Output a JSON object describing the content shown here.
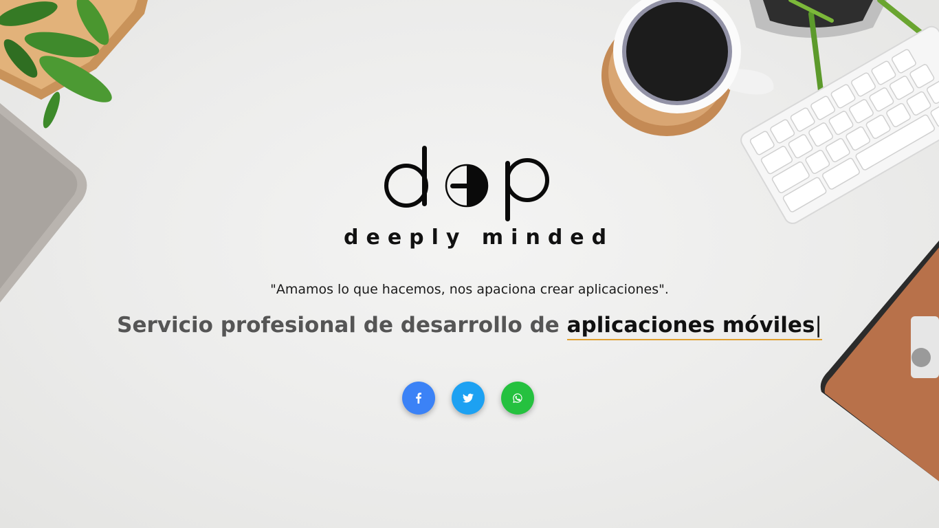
{
  "brand": {
    "logo_mark": "dep",
    "logo_text": "deeply minded"
  },
  "hero": {
    "quote": "\"Amamos lo que hacemos, nos apaciona crear aplicaciones\".",
    "tagline_prefix": "Servicio profesional de desarrollo de ",
    "tagline_highlight": "aplicaciones móviles",
    "cursor": "|"
  },
  "social": [
    {
      "name": "facebook",
      "icon": "facebook-icon",
      "color": "#3b82f6"
    },
    {
      "name": "twitter",
      "icon": "twitter-icon",
      "color": "#1da1f2"
    },
    {
      "name": "whatsapp",
      "icon": "whatsapp-icon",
      "color": "#25c13f"
    }
  ],
  "colors": {
    "accent_underline": "#e0a030",
    "tagline_gray": "#555555"
  }
}
